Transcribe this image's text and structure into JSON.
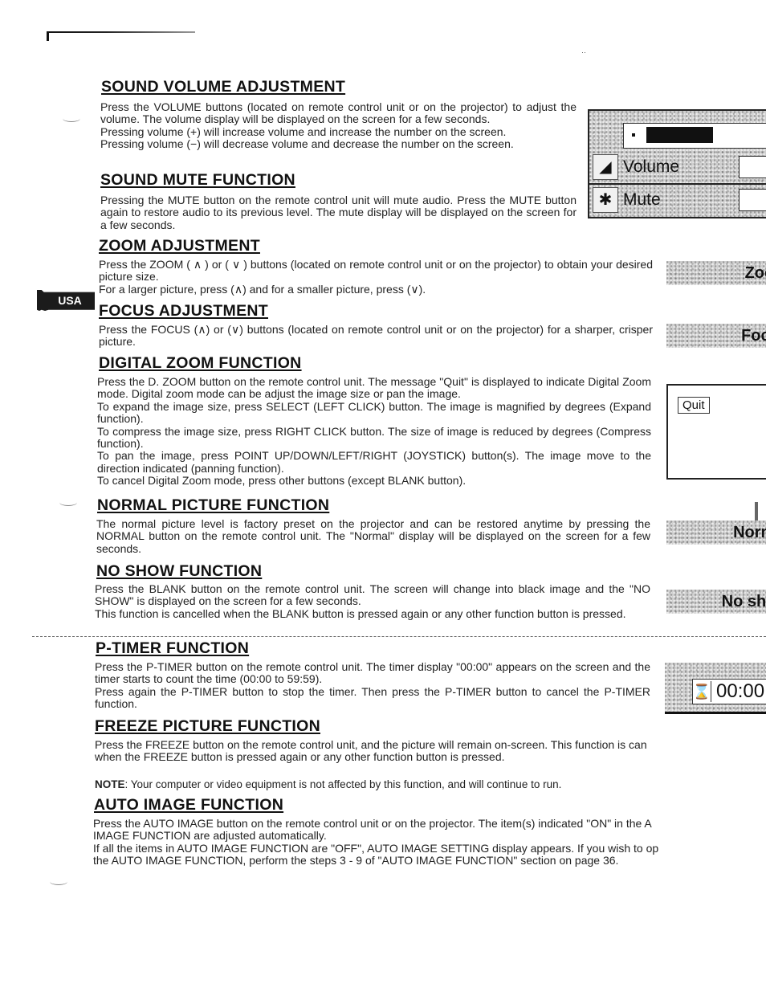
{
  "document": {
    "side_tab": "USA",
    "sections": [
      {
        "heading": "SOUND VOLUME ADJUSTMENT",
        "lines": [
          "Press the VOLUME buttons (located on remote control unit or on the projector) to adjust the volume. The volume display will be displayed on the screen for a few seconds.",
          "Pressing volume (+) will increase volume and increase the number on the screen.",
          "Pressing volume (−) will decrease volume and decrease the number on the screen."
        ]
      },
      {
        "heading": "SOUND MUTE FUNCTION",
        "lines": [
          "Pressing the MUTE button on the remote control unit will mute audio. Press the MUTE button again to restore audio to its previous level. The mute display will be displayed on the screen for a few seconds."
        ]
      },
      {
        "heading": "ZOOM ADJUSTMENT",
        "lines": [
          "Press the ZOOM ( ∧ ) or ( ∨ ) buttons (located on remote control unit or on the projector) to obtain your desired picture size.",
          "For a larger picture, press (∧) and for a smaller picture, press (∨)."
        ]
      },
      {
        "heading": "FOCUS ADJUSTMENT",
        "lines": [
          "Press the FOCUS (∧) or (∨) buttons (located on remote control unit or on the projector) for a sharper, crisper picture."
        ]
      },
      {
        "heading": "DIGITAL ZOOM FUNCTION",
        "lines": [
          "Press the D. ZOOM button on the remote control unit. The message \"Quit\" is displayed to indicate Digital Zoom mode. Digital zoom mode can be adjust the image size or pan the image.",
          "To expand the image size, press SELECT (LEFT CLICK) button.  The image is magnified by degrees (Expand function).",
          "To compress the image size, press RIGHT CLICK button.  The size of image is reduced by degrees (Compress function).",
          "To pan the image, press POINT UP/DOWN/LEFT/RIGHT (JOYSTICK) button(s).  The image move to the direction indicated (panning function).",
          "To cancel Digital Zoom mode, press other buttons (except BLANK button)."
        ]
      },
      {
        "heading": "NORMAL PICTURE FUNCTION",
        "lines": [
          "The normal picture level is factory preset on the projector and can be restored anytime by pressing the NORMAL button on the remote control unit. The \"Normal\" display will be displayed on the screen for a few seconds."
        ]
      },
      {
        "heading": "NO SHOW FUNCTION",
        "lines": [
          "Press the BLANK button on the remote control unit. The screen will change into black image and the \"NO SHOW\" is displayed on the screen for a few seconds.",
          "This function is cancelled when the BLANK button is pressed again or any other function button is pressed."
        ]
      },
      {
        "heading": "P-TIMER FUNCTION",
        "lines": [
          "Press the P-TIMER button on the remote control unit. The timer display \"00:00\" appears on the screen and the timer starts to count the time (00:00 to 59:59).",
          "Press again the P-TIMER button to stop the timer.  Then press the P-TIMER button to cancel the P-TIMER function."
        ]
      },
      {
        "heading": "FREEZE PICTURE FUNCTION",
        "lines": [
          "Press the FREEZE button on the remote control unit, and the picture will remain on-screen. This function is can",
          "when the FREEZE button is pressed again or any other function button is pressed."
        ]
      },
      {
        "heading": "AUTO IMAGE FUNCTION",
        "lines": [
          "Press  the AUTO IMAGE button on the remote control unit or on the projector. The item(s) indicated \"ON\" in the A",
          "IMAGE FUNCTION are adjusted automatically.",
          "If all the items in AUTO IMAGE FUNCTION are \"OFF\", AUTO IMAGE SETTING display appears. If you wish to op",
          "the AUTO IMAGE FUNCTION, perform the steps 3 - 9 of \"AUTO IMAGE FUNCTION\" section on page 36."
        ]
      }
    ],
    "note": {
      "label": "NOTE",
      "text": ": Your computer or video equipment is not affected by this function, and will continue to run."
    }
  },
  "osd": {
    "volume_panel": {
      "level_fraction": 0.55,
      "rows": [
        {
          "icon": "speaker-icon",
          "label": "Volume"
        },
        {
          "icon": "mute-icon",
          "label": "Mute"
        }
      ]
    },
    "zoom_label": "Zoom",
    "focus_label": "Focus",
    "quit_button": "Quit",
    "normal_label": "Normal",
    "noshow_label": "No show",
    "timer_value": "00:00"
  }
}
